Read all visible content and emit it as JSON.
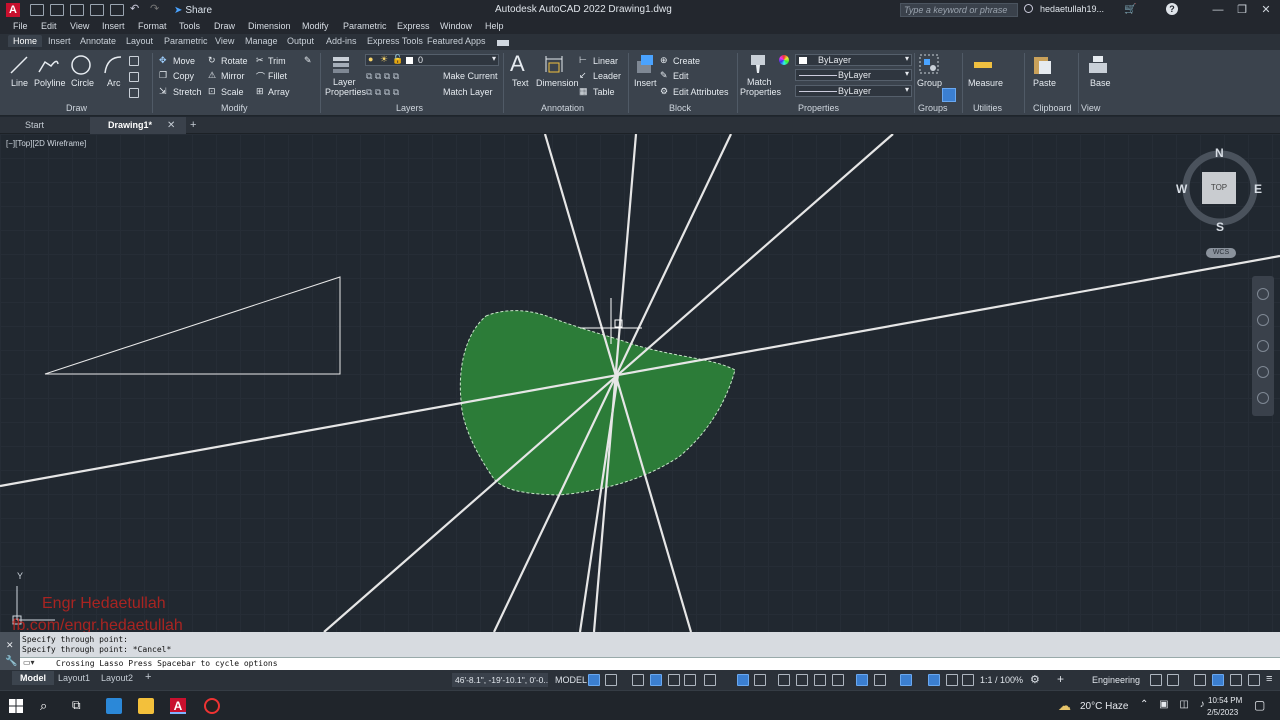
{
  "title_bar": {
    "app_letter": "A",
    "share_label": "Share",
    "window_title": "Autodesk AutoCAD 2022    Drawing1.dwg",
    "search_placeholder": "Type a keyword or phrase",
    "user_name": "hedaetullah19...",
    "help_label": "?"
  },
  "menu": [
    "File",
    "Edit",
    "View",
    "Insert",
    "Format",
    "Tools",
    "Draw",
    "Dimension",
    "Modify",
    "Parametric",
    "Express",
    "Window",
    "Help"
  ],
  "ribbon_tabs": [
    "Home",
    "Insert",
    "Annotate",
    "Layout",
    "Parametric",
    "View",
    "Manage",
    "Output",
    "Add-ins",
    "Express Tools",
    "Featured Apps"
  ],
  "ribbon": {
    "draw": {
      "title": "Draw",
      "line": "Line",
      "polyline": "Polyline",
      "circle": "Circle",
      "arc": "Arc"
    },
    "modify": {
      "title": "Modify",
      "move": "Move",
      "rotate": "Rotate",
      "trim": "Trim",
      "copy": "Copy",
      "mirror": "Mirror",
      "fillet": "Fillet",
      "stretch": "Stretch",
      "scale": "Scale",
      "array": "Array"
    },
    "layers": {
      "title": "Layers",
      "layer_properties_1": "Layer",
      "layer_properties_2": "Properties",
      "current_layer": "0",
      "make_current": "Make Current",
      "match_layer": "Match Layer"
    },
    "annotation": {
      "title": "Annotation",
      "text": "Text",
      "dimension": "Dimension",
      "linear": "Linear",
      "leader": "Leader",
      "table": "Table"
    },
    "block": {
      "title": "Block",
      "insert": "Insert",
      "create": "Create",
      "edit": "Edit",
      "edit_attributes": "Edit Attributes"
    },
    "properties": {
      "title": "Properties",
      "match_1": "Match",
      "match_2": "Properties",
      "color": "ByLayer",
      "linetype": "ByLayer",
      "lineweight": "ByLayer"
    },
    "groups": {
      "title": "Groups",
      "group": "Group"
    },
    "utilities": {
      "title": "Utilities",
      "measure": "Measure"
    },
    "clipboard": {
      "title": "Clipboard",
      "paste": "Paste"
    },
    "view": {
      "title": "View",
      "base": "Base"
    }
  },
  "doc_tabs": {
    "start": "Start",
    "drawing": "Drawing1*",
    "close": "✕",
    "add": "+"
  },
  "canvas": {
    "viewport_label": "[−][Top][2D Wireframe]",
    "viewcube": {
      "n": "N",
      "s": "S",
      "e": "E",
      "w": "W",
      "top": "TOP",
      "wcs": "WCS"
    },
    "ucs_y": "Y",
    "watermark_line1": "Engr Hedaetullah",
    "watermark_line2": "fb.com/engr.hedaetullah",
    "colors": {
      "lasso_fill": "#2e8b3a",
      "lines": "#e6e6e6",
      "background": "#212830"
    }
  },
  "command": {
    "history": [
      "Specify through point:",
      "Specify through point: *Cancel*"
    ],
    "input": "Crossing Lasso  Press Spacebar to cycle options"
  },
  "status": {
    "layouts": [
      "Model",
      "Layout1",
      "Layout2"
    ],
    "add_layout": "+",
    "coordinates": "46'-8.1\", -19'-10.1\", 0'-0...",
    "space": "MODEL",
    "scale": "1:1 / 100%",
    "workspace": "Engineering"
  },
  "taskbar": {
    "weather": "20°C  Haze",
    "time": "10:54 PM",
    "date": "2/5/2023"
  }
}
